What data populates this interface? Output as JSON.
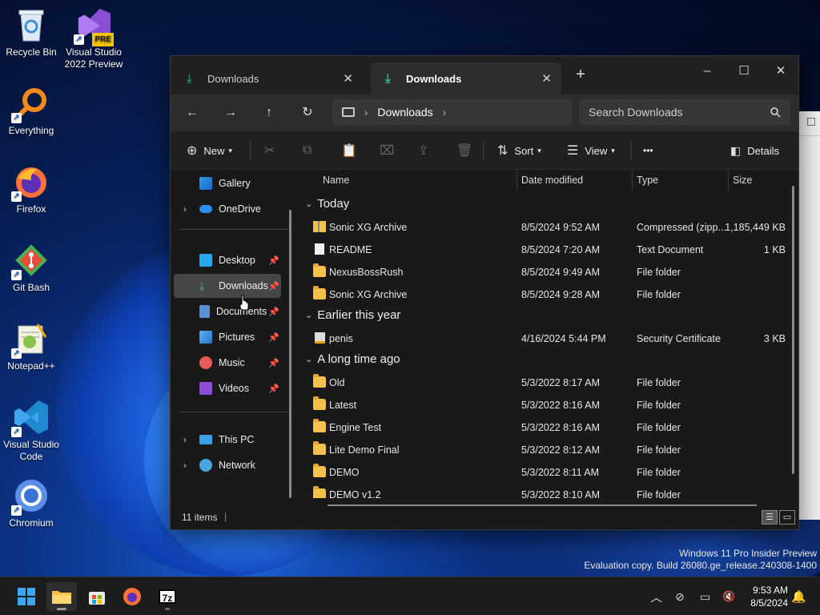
{
  "desktop": {
    "icons": [
      {
        "label": "Recycle Bin"
      },
      {
        "label": "Visual Studio 2022 Preview",
        "badge": "PRE"
      },
      {
        "label": "Everything"
      },
      {
        "label": "Firefox"
      },
      {
        "label": "Git Bash"
      },
      {
        "label": "Notepad++"
      },
      {
        "label": "Visual Studio Code"
      },
      {
        "label": "Chromium"
      }
    ],
    "watermark": {
      "line1": "Windows 11 Pro Insider Preview",
      "line2": "Evaluation copy. Build 26080.ge_release.240308-1400"
    }
  },
  "explorer": {
    "tabs": [
      {
        "label": "Downloads",
        "icon": "download-icon",
        "active": false
      },
      {
        "label": "Downloads",
        "icon": "download-icon",
        "active": true
      }
    ],
    "new_tab": "+",
    "window_controls": {
      "minimize": "–",
      "maximize": "☐",
      "close": "✕"
    },
    "nav": {
      "back": "←",
      "forward": "→",
      "up": "↑",
      "refresh": "↻"
    },
    "address": {
      "location": "Downloads",
      "sep1": "›",
      "sep2": "›"
    },
    "search": {
      "placeholder": "Search Downloads"
    },
    "commands": {
      "new": "New",
      "sort": "Sort",
      "view": "View",
      "more": "•••",
      "details": "Details"
    },
    "sidebar": {
      "gallery": "Gallery",
      "onedrive": "OneDrive",
      "desktop": "Desktop",
      "downloads": "Downloads",
      "documents": "Documents",
      "pictures": "Pictures",
      "music": "Music",
      "videos": "Videos",
      "this_pc": "This PC",
      "network": "Network"
    },
    "columns": {
      "name": "Name",
      "date": "Date modified",
      "type": "Type",
      "size": "Size"
    },
    "groups": {
      "today": "Today",
      "earlier": "Earlier this year",
      "longago": "A long time ago"
    },
    "files": [
      {
        "name": "Sonic XG Archive",
        "date": "8/5/2024 9:52 AM",
        "type": "Compressed (zipp...",
        "size": "1,185,449 KB"
      },
      {
        "name": "README",
        "date": "8/5/2024 7:20 AM",
        "type": "Text Document",
        "size": "1 KB"
      },
      {
        "name": "NexusBossRush",
        "date": "8/5/2024 9:49 AM",
        "type": "File folder",
        "size": ""
      },
      {
        "name": "Sonic XG Archive",
        "date": "8/5/2024 9:28 AM",
        "type": "File folder",
        "size": ""
      },
      {
        "name": "penis",
        "date": "4/16/2024 5:44 PM",
        "type": "Security Certificate",
        "size": "3 KB"
      },
      {
        "name": "Old",
        "date": "5/3/2022 8:17 AM",
        "type": "File folder",
        "size": ""
      },
      {
        "name": "Latest",
        "date": "5/3/2022 8:16 AM",
        "type": "File folder",
        "size": ""
      },
      {
        "name": "Engine Test",
        "date": "5/3/2022 8:16 AM",
        "type": "File folder",
        "size": ""
      },
      {
        "name": "Lite Demo Final",
        "date": "5/3/2022 8:12 AM",
        "type": "File folder",
        "size": ""
      },
      {
        "name": "DEMO",
        "date": "5/3/2022 8:11 AM",
        "type": "File folder",
        "size": ""
      },
      {
        "name": "DEMO v1.2",
        "date": "5/3/2022 8:10 AM",
        "type": "File folder",
        "size": ""
      }
    ],
    "status": {
      "count": "11 items",
      "sep": "|"
    }
  },
  "taskbar": {
    "clock_time": "9:53 AM",
    "clock_date": "8/5/2024"
  },
  "colors": {
    "accent_green": "#3dba7a",
    "folder_yellow": "#f4c14b",
    "window_bg": "#191919"
  }
}
